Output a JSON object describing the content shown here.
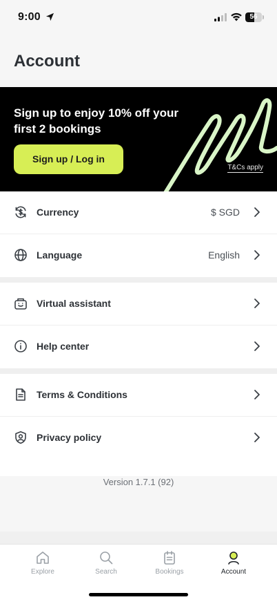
{
  "status_bar": {
    "time": "9:00",
    "battery": "56",
    "battery_level_pct": 56
  },
  "page": {
    "title": "Account"
  },
  "promo": {
    "headline": "Sign up to enjoy 10% off your first 2 bookings",
    "button_label": "Sign up / Log in",
    "terms_label": "T&Cs apply",
    "accent_color": "#d7ee55",
    "swoosh_color": "#d9f5c7"
  },
  "settings": {
    "currency": {
      "label": "Currency",
      "value": "$ SGD",
      "icon": "currency-exchange-icon"
    },
    "language": {
      "label": "Language",
      "value": "English",
      "icon": "globe-icon"
    },
    "assistant": {
      "label": "Virtual assistant",
      "icon": "bot-icon"
    },
    "help": {
      "label": "Help center",
      "icon": "info-icon"
    },
    "terms": {
      "label": "Terms & Conditions",
      "icon": "document-icon"
    },
    "privacy": {
      "label": "Privacy policy",
      "icon": "shield-user-icon"
    }
  },
  "version": "Version 1.7.1 (92)",
  "tabs": {
    "explore": "Explore",
    "search": "Search",
    "bookings": "Bookings",
    "account": "Account",
    "active": "account"
  }
}
